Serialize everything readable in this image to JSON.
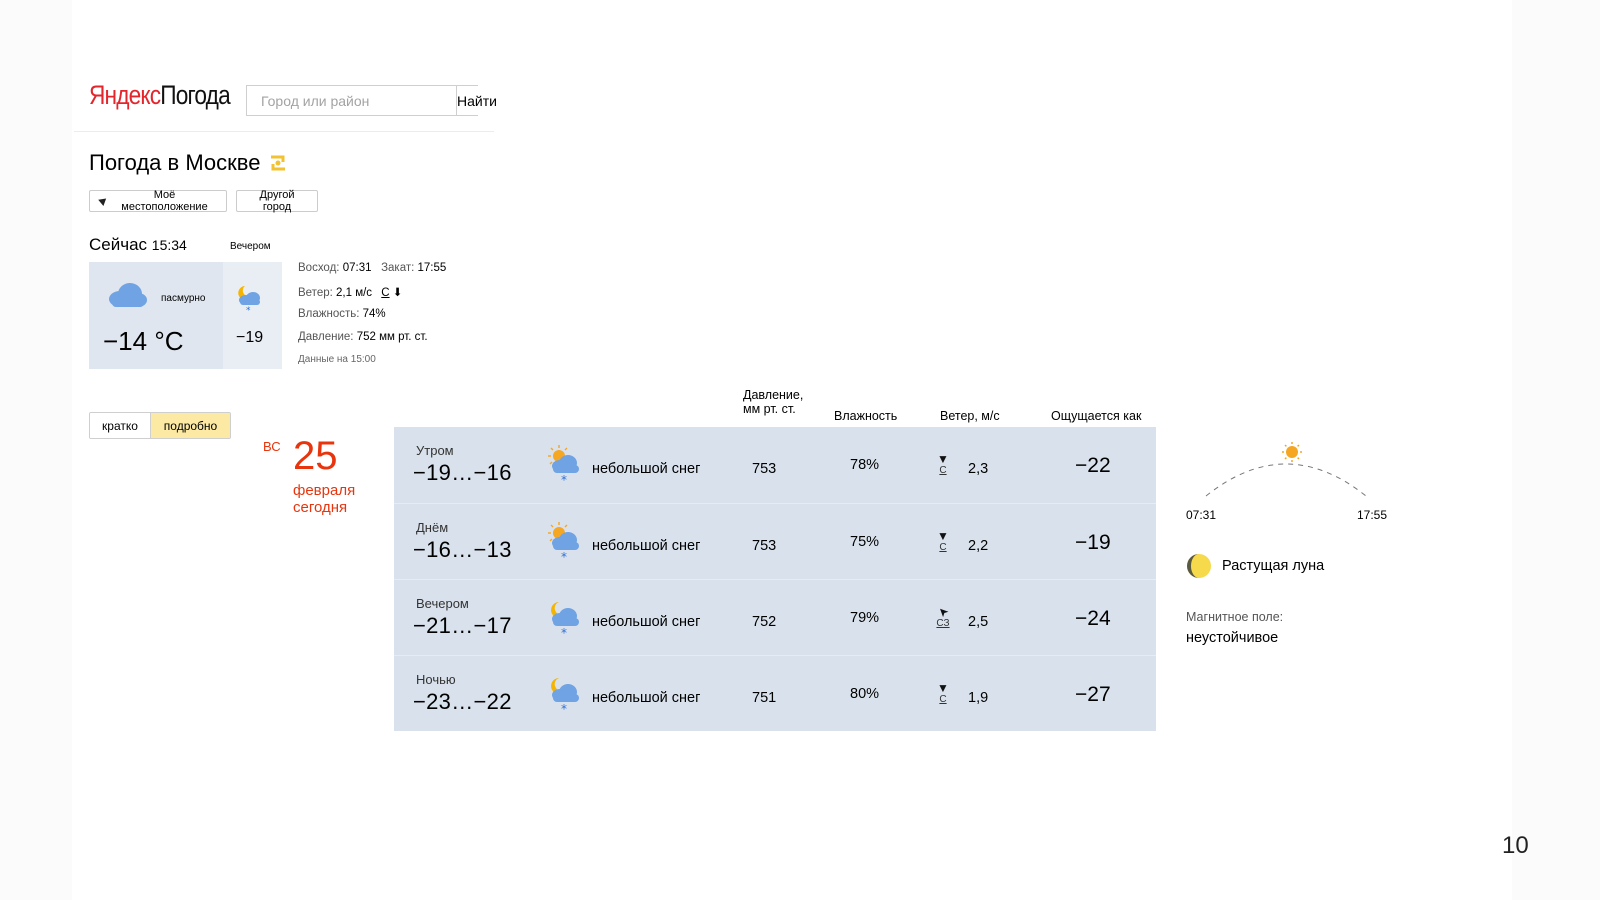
{
  "header": {
    "logo_brand": "Яндекс",
    "logo_service": "Погода",
    "search_placeholder": "Город или район",
    "search_button": "Найти"
  },
  "title": "Погода в Москве",
  "location_buttons": {
    "my_location": "Моё местоположение",
    "other_city": "Другой город"
  },
  "now": {
    "label": "Сейчас",
    "time": "15:34",
    "condition": "пасмурно",
    "temperature": "−14 °C",
    "icon": "cloud-icon"
  },
  "evening": {
    "label": "Вечером",
    "temperature": "−19",
    "icon": "moon-cloud-snow-icon"
  },
  "details": {
    "sunrise_label": "Восход:",
    "sunrise": "07:31",
    "sunset_label": "Закат:",
    "sunset": "17:55",
    "wind_label": "Ветер:",
    "wind_value": "2,1 м/с",
    "wind_dir": "С",
    "humidity_label": "Влажность:",
    "humidity_value": "74%",
    "pressure_label": "Давление:",
    "pressure_value": "752 мм рт. ст.",
    "data_time": "Данные на 15:00"
  },
  "view_toggle": {
    "brief": "кратко",
    "detailed": "подробно",
    "active": "detailed"
  },
  "date": {
    "day_of_week": "ВС",
    "day": "25",
    "month": "февраля",
    "relative": "сегодня"
  },
  "columns": {
    "pressure_line1": "Давление,",
    "pressure_line2": "мм рт. ст.",
    "humidity": "Влажность",
    "wind": "Ветер, м/с",
    "feels_like": "Ощущается как"
  },
  "rows": [
    {
      "time_of_day": "Утром",
      "range": "−19…−16",
      "icon": "sun-cloud-snow-icon",
      "condition": "небольшой снег",
      "pressure": "753",
      "humidity": "78%",
      "wind_dir": "С",
      "wind_speed": "2,3",
      "feels_like": "−22"
    },
    {
      "time_of_day": "Днём",
      "range": "−16…−13",
      "icon": "sun-cloud-snow-icon",
      "condition": "небольшой снег",
      "pressure": "753",
      "humidity": "75%",
      "wind_dir": "С",
      "wind_speed": "2,2",
      "feels_like": "−19"
    },
    {
      "time_of_day": "Вечером",
      "range": "−21…−17",
      "icon": "moon-cloud-snow-icon",
      "condition": "небольшой снег",
      "pressure": "752",
      "humidity": "79%",
      "wind_dir": "СЗ",
      "wind_speed": "2,5",
      "feels_like": "−24"
    },
    {
      "time_of_day": "Ночью",
      "range": "−23…−22",
      "icon": "moon-cloud-snow-icon",
      "condition": "небольшой снег",
      "pressure": "751",
      "humidity": "80%",
      "wind_dir": "С",
      "wind_speed": "1,9",
      "feels_like": "−27"
    }
  ],
  "sun": {
    "sunrise": "07:31",
    "sunset": "17:55"
  },
  "moon": {
    "phase": "Растущая луна"
  },
  "magnetic": {
    "label": "Магнитное поле:",
    "value": "неустойчивое"
  },
  "page_number": "10",
  "colors": {
    "brand_red": "#e4262c",
    "date_red": "#e8350d",
    "table_bg": "#d9e2ec",
    "toggle_active": "#fbe9a4",
    "sun_orange": "#f5a623"
  }
}
